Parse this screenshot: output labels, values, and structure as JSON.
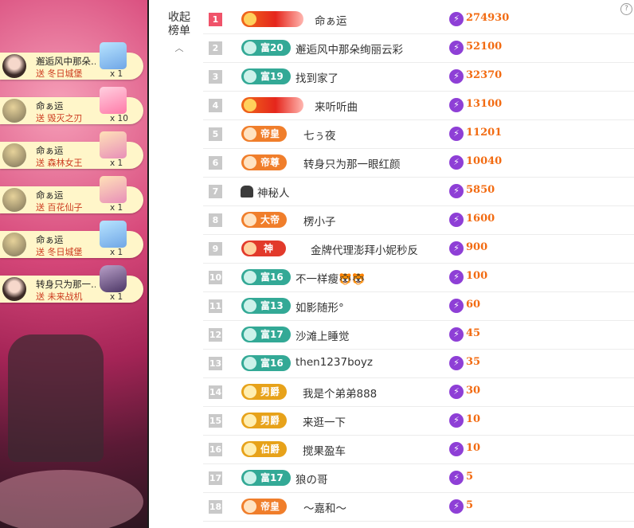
{
  "gift_feed": [
    {
      "user": "邂逅风中那朵…",
      "gift_text": "送 冬日城堡",
      "count": "x 1",
      "icon": "castle-gift-icon",
      "avatar": "girl"
    },
    {
      "user": "命ぁ运",
      "gift_text": "送 毁灭之刃",
      "count": "x 10",
      "icon": "rose-gift-icon",
      "avatar": "cat"
    },
    {
      "user": "命ぁ运",
      "gift_text": "送 森林女王",
      "count": "x 1",
      "icon": "queen-gift-icon",
      "avatar": "cat"
    },
    {
      "user": "命ぁ运",
      "gift_text": "送 百花仙子",
      "count": "x 1",
      "icon": "fairy-gift-icon",
      "avatar": "cat"
    },
    {
      "user": "命ぁ运",
      "gift_text": "送 冬日城堡",
      "count": "x 1",
      "icon": "castle-gift-icon",
      "avatar": "cat"
    },
    {
      "user": "转身只为那一…",
      "gift_text": "送 未来战机",
      "count": "x 1",
      "icon": "jet-gift-icon",
      "avatar": "girl"
    }
  ],
  "ranking": {
    "collapse_label": "收起榜单",
    "collapse_icon": "chevron-up-icon",
    "rows": [
      {
        "rank": "1",
        "badge_type": "red",
        "badge_label": "",
        "user": "命ぁ运",
        "score": "274930"
      },
      {
        "rank": "2",
        "badge_type": "fu",
        "badge_label": "富20",
        "user": "邂逅风中那朵绚丽云彩",
        "score": "52100"
      },
      {
        "rank": "3",
        "badge_type": "fu",
        "badge_label": "富19",
        "user": "找到家了",
        "score": "32370"
      },
      {
        "rank": "4",
        "badge_type": "red",
        "badge_label": "",
        "user": "来听听曲",
        "score": "13100"
      },
      {
        "rank": "5",
        "badge_type": "dh",
        "badge_label": "帝皇",
        "user": "七ぅ夜",
        "score": "11201"
      },
      {
        "rank": "6",
        "badge_type": "dh",
        "badge_label": "帝尊",
        "user": "转身只为那一眼红颜",
        "score": "10040"
      },
      {
        "rank": "7",
        "badge_type": "mystery",
        "badge_label": "",
        "user": "神秘人",
        "score": "5850"
      },
      {
        "rank": "8",
        "badge_type": "dh",
        "badge_label": "大帝",
        "user": "楞小子",
        "score": "1600"
      },
      {
        "rank": "9",
        "badge_type": "shen",
        "badge_label": "神",
        "user": "金牌代理澎拜小妮秒反",
        "score": "900"
      },
      {
        "rank": "10",
        "badge_type": "fu",
        "badge_label": "富16",
        "user": "不一样瘦🐯🐯",
        "score": "100"
      },
      {
        "rank": "11",
        "badge_type": "fu",
        "badge_label": "富13",
        "user": "如影随形°",
        "score": "60"
      },
      {
        "rank": "12",
        "badge_type": "fu",
        "badge_label": "富17",
        "user": "沙滩上睡觉",
        "score": "45"
      },
      {
        "rank": "13",
        "badge_type": "fu",
        "badge_label": "富16",
        "user": "then1237boyz",
        "score": "35"
      },
      {
        "rank": "14",
        "badge_type": "nj",
        "badge_label": "男爵",
        "user": "我是个弟弟888",
        "score": "30"
      },
      {
        "rank": "15",
        "badge_type": "nj",
        "badge_label": "男爵",
        "user": "来逛一下",
        "score": "10"
      },
      {
        "rank": "16",
        "badge_type": "bj",
        "badge_label": "伯爵",
        "user": "搅果盈车",
        "score": "10"
      },
      {
        "rank": "17",
        "badge_type": "fu",
        "badge_label": "富17",
        "user": "狼の哥",
        "score": "5"
      },
      {
        "rank": "18",
        "badge_type": "dh",
        "badge_label": "帝皇",
        "user": "～嘉和～",
        "score": "5"
      }
    ]
  },
  "colors": {
    "score": "#f26b12",
    "rank_first": "#f0536a",
    "fu_badge": "#33a996",
    "coin": "#8e3fd6"
  }
}
